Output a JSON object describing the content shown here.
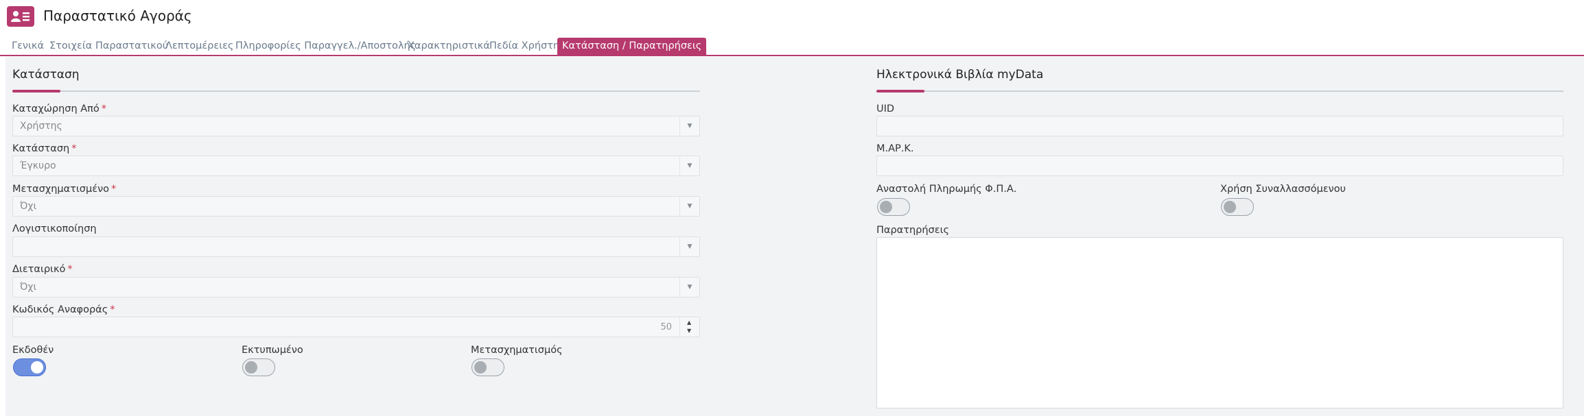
{
  "header": {
    "title": "Παραστατικό Αγοράς",
    "icon": "contact-card-icon",
    "accent": "#b63a6e"
  },
  "tabs": [
    {
      "label": "Γενικά"
    },
    {
      "label": "Στοιχεία Παραστατικού"
    },
    {
      "label": "Λεπτομέρειες"
    },
    {
      "label": "Πληροφορίες Παραγγελ./Αποστολής"
    },
    {
      "label": "Χαρακτηριστικά"
    },
    {
      "label": "Πεδία Χρήστη"
    },
    {
      "label": "Κατάσταση / Παρατηρήσεις",
      "active": true
    }
  ],
  "status_section": {
    "title": "Κατάσταση",
    "registered_by": {
      "label": "Καταχώρηση Από",
      "required": "*",
      "value": "Χρήστης"
    },
    "status": {
      "label": "Κατάσταση",
      "required": "*",
      "value": "Έγκυρο"
    },
    "transformed": {
      "label": "Μετασχηματισμένο",
      "required": "*",
      "value": "Όχι"
    },
    "accounting": {
      "label": "Λογιστικοποίηση",
      "value": ""
    },
    "interbranch": {
      "label": "Διεταιρικό",
      "required": "*",
      "value": "Όχι"
    },
    "reference_code": {
      "label": "Κωδικός Αναφοράς",
      "required": "*",
      "value": "50"
    },
    "issued": {
      "label": "Εκδοθέν",
      "on": true
    },
    "printed": {
      "label": "Εκτυπωμένο",
      "on": false
    },
    "transformation": {
      "label": "Μετασχηματισμός",
      "on": false
    }
  },
  "mydata_section": {
    "title": "Ηλεκτρονικά Βιβλία myData",
    "uid": {
      "label": "UID",
      "value": ""
    },
    "mark": {
      "label": "Μ.ΑΡ.Κ.",
      "value": ""
    },
    "vat_suspension": {
      "label": "Αναστολή Πληρωμής Φ.Π.Α.",
      "on": false
    },
    "counterparty_use": {
      "label": "Χρήση Συναλλασσόμενου",
      "on": false
    },
    "notes": {
      "label": "Παρατηρήσεις",
      "value": ""
    }
  }
}
